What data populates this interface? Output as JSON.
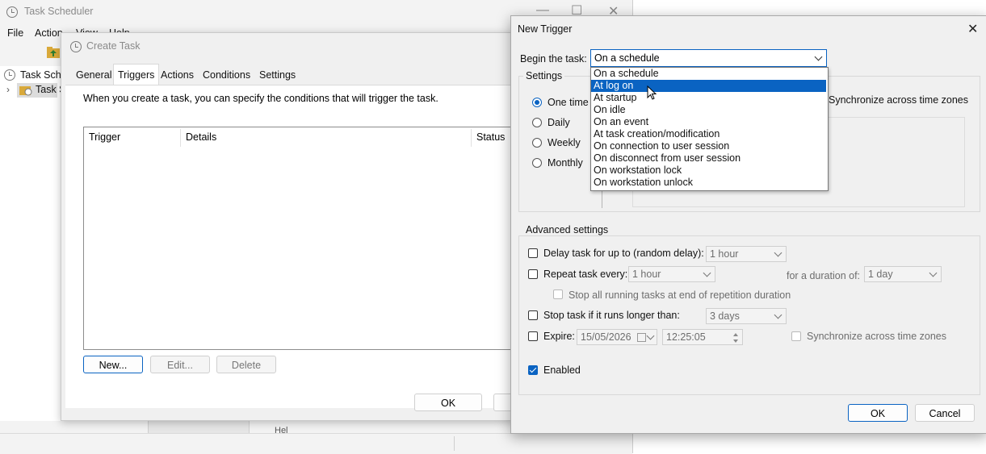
{
  "main_window": {
    "title": "Task Scheduler",
    "menu": [
      "File",
      "Action",
      "View",
      "Help"
    ],
    "tree": [
      "Task Sche",
      "Task S"
    ],
    "partial_text": "Hel"
  },
  "create_task": {
    "title": "Create Task",
    "tabs": [
      "General",
      "Triggers",
      "Actions",
      "Conditions",
      "Settings"
    ],
    "active_tab": "Triggers",
    "description": "When you create a task, you can specify the conditions that will trigger the task.",
    "columns": [
      "Trigger",
      "Details",
      "Status"
    ],
    "buttons": {
      "new": "New...",
      "edit": "Edit...",
      "delete": "Delete",
      "ok": "OK"
    }
  },
  "new_trigger": {
    "title": "New Trigger",
    "begin_label": "Begin the task:",
    "begin_value": "On a schedule",
    "dropdown_options": [
      "On a schedule",
      "At log on",
      "At startup",
      "On idle",
      "On an event",
      "At task creation/modification",
      "On connection to user session",
      "On disconnect from user session",
      "On workstation lock",
      "On workstation unlock"
    ],
    "highlighted_option": "At log on",
    "settings_label": "Settings",
    "schedule_options": [
      "One time",
      "Daily",
      "Weekly",
      "Monthly"
    ],
    "selected_schedule": "One time",
    "sync_label": "Synchronize across time zones",
    "advanced_label": "Advanced settings",
    "delay_label": "Delay task for up to (random delay):",
    "delay_value": "1 hour",
    "repeat_label": "Repeat task every:",
    "repeat_value": "1 hour",
    "duration_label": "for a duration of:",
    "duration_value": "1 day",
    "stop_all_label": "Stop all running tasks at end of repetition duration",
    "stop_if_label": "Stop task if it runs longer than:",
    "stop_if_value": "3 days",
    "expire_label": "Expire:",
    "expire_date": "15/05/2026",
    "expire_time": "12:25:05",
    "expire_sync_label": "Synchronize across time zones",
    "enabled_label": "Enabled",
    "enabled_checked": true,
    "ok_label": "OK",
    "cancel_label": "Cancel"
  },
  "colors": {
    "accent": "#0a63c2",
    "dialog_bg": "#f0f0f0",
    "disabled_text": "#6d6d6d"
  }
}
